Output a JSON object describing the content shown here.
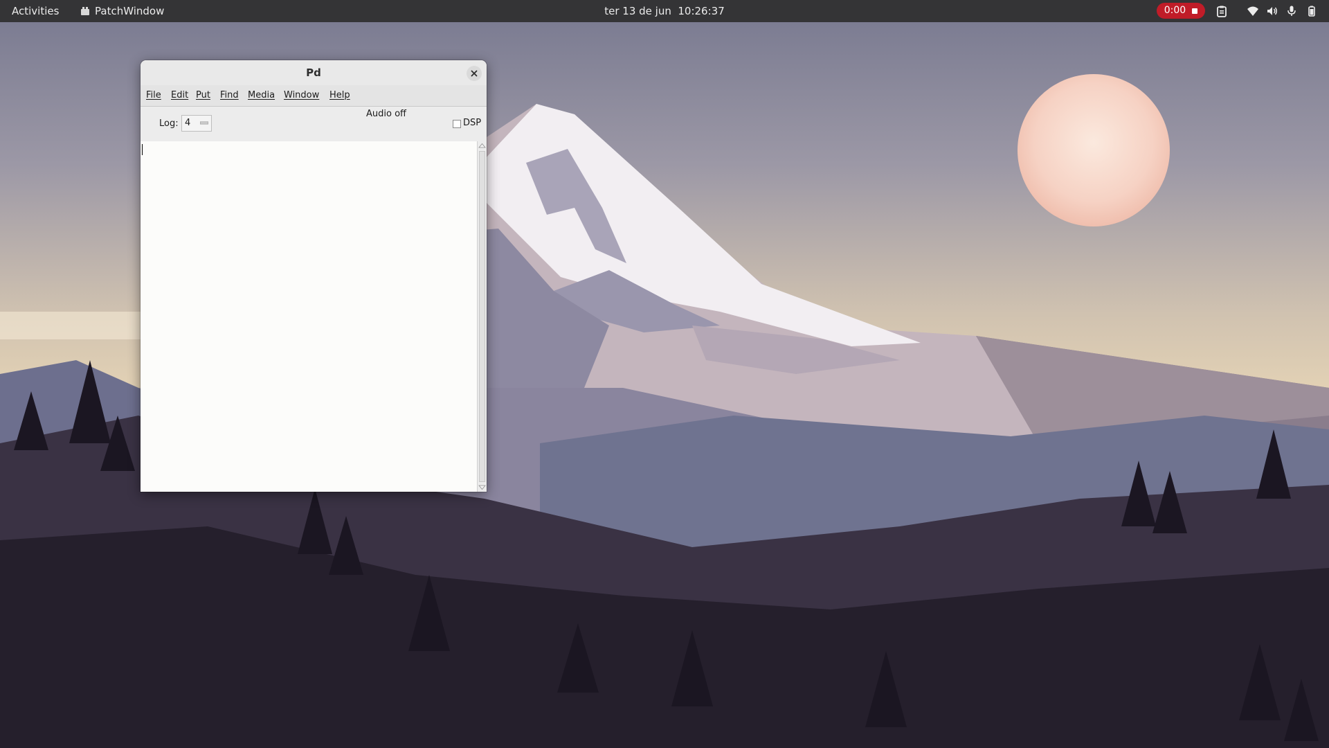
{
  "topbar": {
    "activities": "Activities",
    "app_name": "PatchWindow",
    "app_icon": "pd-app-icon",
    "clock": "ter 13 de jun  10:26:37",
    "recording": {
      "time": "0:00",
      "color": "#c01c28"
    },
    "tray_icons": [
      "clipboard-icon",
      "wifi-icon",
      "volume-icon",
      "microphone-icon",
      "battery-icon"
    ]
  },
  "pd_window": {
    "title": "Pd",
    "close_icon": "close-icon",
    "menu": [
      "File",
      "Edit",
      "Put",
      "Find",
      "Media",
      "Window",
      "Help"
    ],
    "log_label": "Log:",
    "log_value": "4",
    "audio_status": "Audio off",
    "dsp_label": "DSP",
    "dsp_checked": false,
    "console_text": ""
  },
  "colors": {
    "topbar_bg": "#343436",
    "window_bg": "#ececec",
    "console_bg": "#fcfcfa",
    "record_red": "#c01c28"
  }
}
